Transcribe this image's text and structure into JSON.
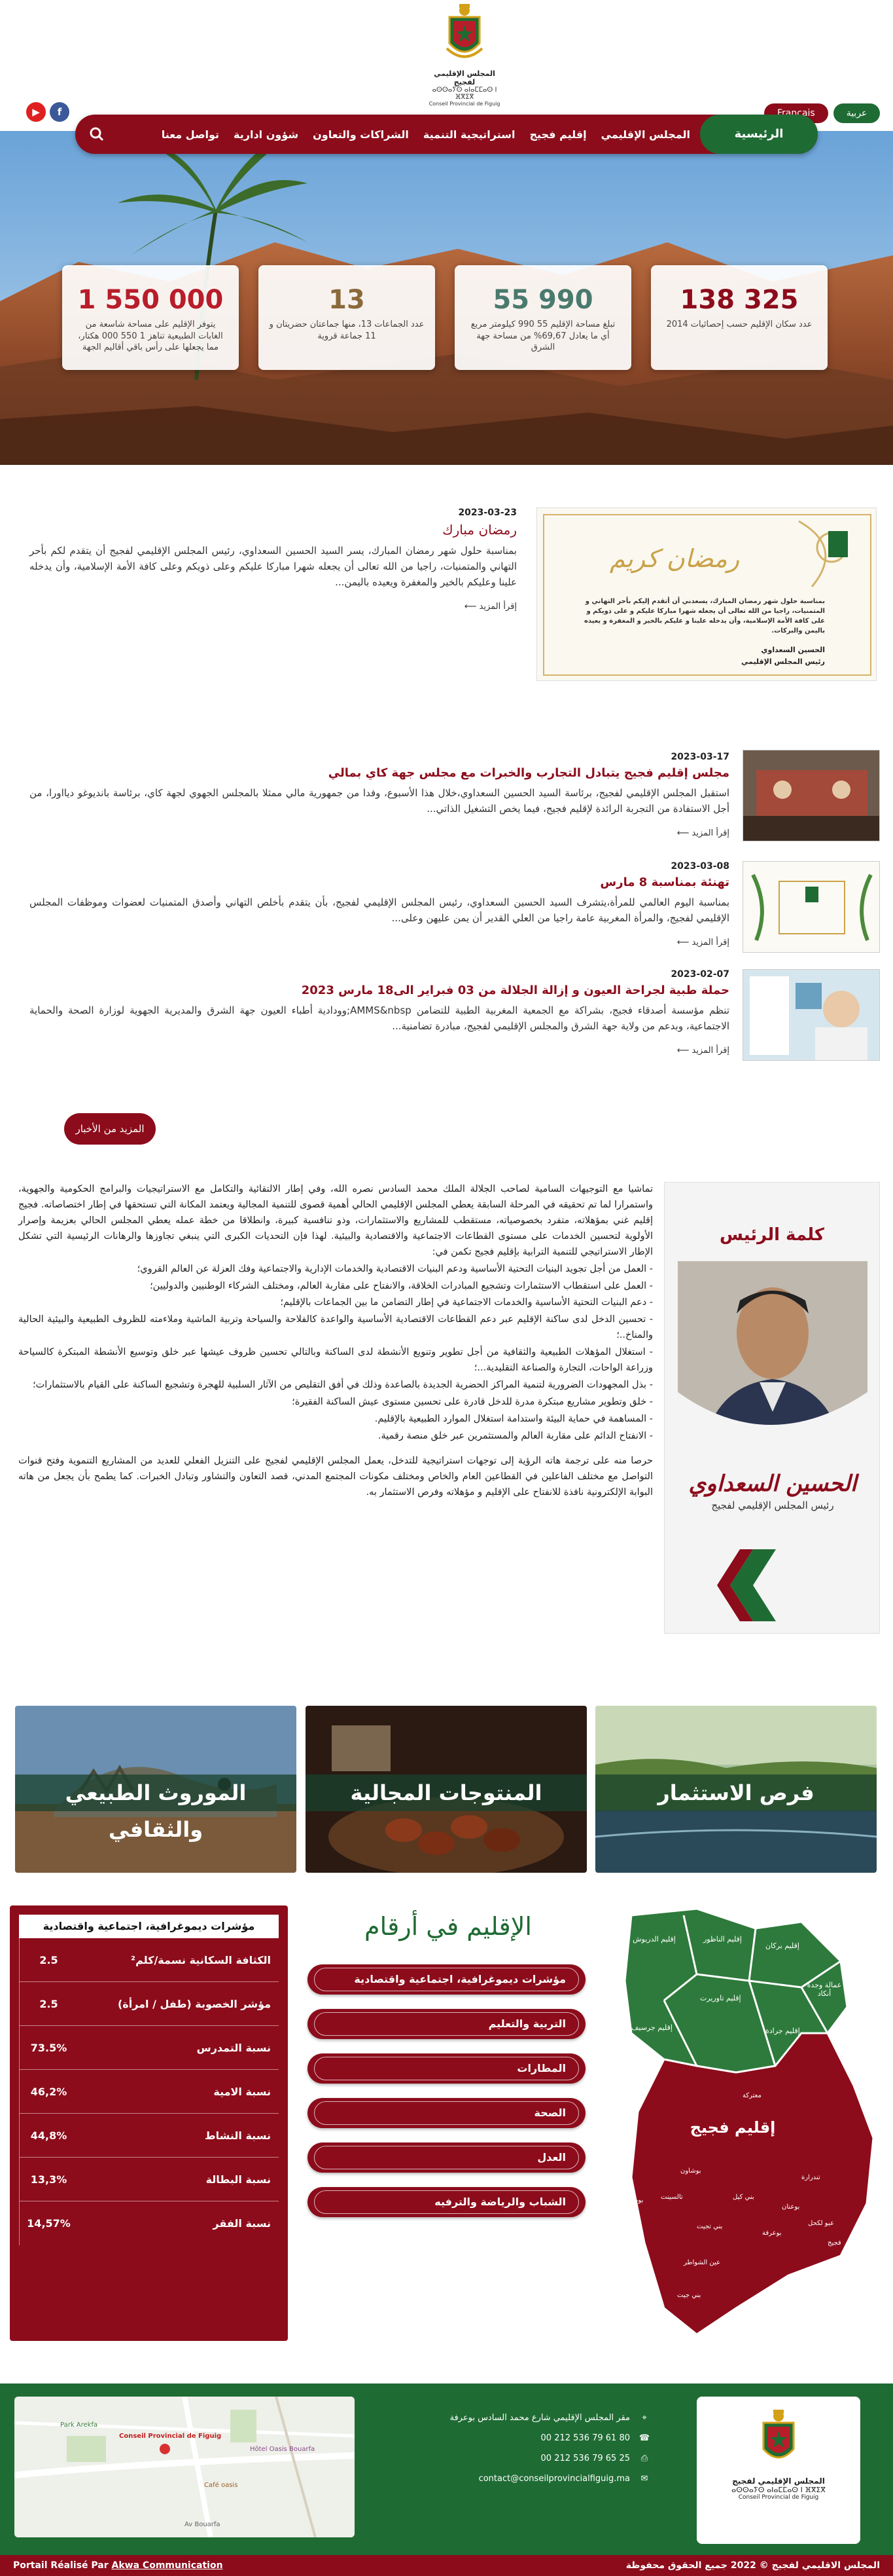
{
  "header": {
    "logo_lines": [
      "المجلس الإقليمي لفجيج",
      "ⴰⵙⵙⴰⵢⵙ ⴰⵏⴰⵎⵎⴰⵙ ⵏ ⴼⴳⵉⴳ",
      "Conseil Provincial de Figuig"
    ],
    "lang_ar": "عربية",
    "lang_fr": "Français",
    "nav_home": "الرئيسية",
    "nav_items": [
      "المجلس الإقليمي",
      "إقليم فجيج",
      "استراتيجية التنمية",
      "الشراكات والتعاون",
      "شؤون ادارية",
      "تواصل معنا"
    ]
  },
  "stats": [
    {
      "num": "138 325",
      "desc": "عدد سكان الإقليم حسب إحصائيات 2014",
      "color": "#8c0c1b"
    },
    {
      "num": "55 990",
      "desc": "تبلغ مساحة الإقليم 55 990 كيلومتر مربع أي ما يعادل 69,67% من مساحة جهة الشرق",
      "color": "#4a7a6e"
    },
    {
      "num": "13",
      "desc": "عدد الجماعات 13، منها جماعتان حضريتان و 11 جماعة قروية",
      "color": "#8a6a3a"
    },
    {
      "num": "1 550 000",
      "desc": "يتوفر الإقليم على مساحة شاسعة من الغابات الطبيعية تناهز 1 550 000 هكتار، مما يجعلها على رأس باقي أقاليم الجهة",
      "color": "#b81d2a"
    }
  ],
  "news": [
    {
      "date": "2023-03-23",
      "title": "رمضان مبارك",
      "excerpt": "بمناسبة حلول شهر رمضان المبارك، يسر السيد الحسين السعداوي، رئيس المجلس الإقليمي لفجيج أن يتقدم لكم بأحر التهاني والمتمنيات، راجيا من الله تعالى أن يجعله شهرا مباركا عليكم وعلى ذويكم وعلى كافة الأمة الإسلامية، وأن يدخله علينا وعليكم بالخير والمغفرة ويعيده باليمن...",
      "read_more": "إقرأ المزيد"
    },
    {
      "date": "2023-03-17",
      "title": "مجلس إقليم فجيج يتبادل التجارب والخبرات مع مجلس جهة كاي بمالي",
      "excerpt": "استقبل المجلس الإقليمي لفجيج، برئاسة السيد الحسين السعداوي،خلال هذا الأسبوع، وفدا من جمهورية مالي ممثلا بالمجلس الجهوي لجهة كاي، برئاسة بانديوغو ديااورا، من أجل الاستفادة من التجربة الرائدة لإقليم فجيج، فيما يخص التشغيل الذاتي...",
      "read_more": "إقرأ المزيد"
    },
    {
      "date": "2023-03-08",
      "title": "تهنئة بمناسبة 8 مارس",
      "excerpt": "بمناسبة اليوم العالمي للمرأة،يتشرف السيد الحسين السعداوي، رئيس المجلس الإقليمي لفجيج، بأن يتقدم بأخلص التهاني وأصدق المتمنيات لعضوات وموظفات المجلس الإقليمي لفجيج، والمرأة المغربية عامة راجيا من العلي القدير أن يمن عليهن وعلى...",
      "read_more": "إقرأ المزيد"
    },
    {
      "date": "2023-02-07",
      "title": "حملة طبية لجراحة العيون و إزالة الجلالة من 03 فبراير الى18 مارس 2023",
      "excerpt": "تنظم مؤسسة أصدقاء فجيج، بشراكة مع الجمعية المغربية الطبية للتضامن AMMS&nbsp;وودادية أطباء العيون جهة الشرق والمديرية الجهوية لوزارة الصحة والحماية الاجتماعية، وبدعم من ولاية جهة الشرق والمجلس الإقليمي لفجيج، مبادرة تضامنية...",
      "read_more": "إقرأ المزيد"
    }
  ],
  "featured_card": {
    "greeting": "رمضان كريم",
    "text": "بمناسبة حلول شهر رمضان المبارك، يسعدني أن أتقدم إليكم بأحر التهاني و المتمنيات، راجيا من الله تعالى أن يجعله شهرا مباركا عليكم و على ذويكم و على كافة الأمة الإسلامية، وأن يدخله علينا و عليكم بالخير و المغفرة و يعيده باليمن والبركات.",
    "signature": "الحسين السعداوي",
    "signature_role": "رئيس المجلس الإقليمي"
  },
  "more_button": "المزيد من الأخبار",
  "president": {
    "heading": "كلمة الرئيس",
    "name": "الحسين السعداوي",
    "role": "رئيس المجلس الإقليمي لفجيج",
    "paragraphs": [
      "تماشيا مع التوجيهات السامية لصاحب الجلالة الملك محمد السادس نصره الله، وفي إطار الالتقائية والتكامل مع الاستراتيجيات والبرامج الحكومية والجهوية، واستمرارا لما تم تحقيقه في المرحلة السابقة يعطي المجلس الإقليمي الحالي أهمية قصوى للتنمية المجالية ويعتمد المكانة التي تستحقها في إطار اختصاصاته. فجيج إقليم غني بمؤهلاته، متفرد بخصوصياته، مستقطب للمشاريع والاستثمارات، وذو تنافسية كبيرة، وانطلاقا من خطة عمله يعطي المجلس الحالي بعزيمة وإصرار الأولوية لتحسين الخدمات على مستوى القطاعات الاجتماعية والاقتصادية والبيئية. لهذا فإن التحديات الكبرى التي ينبغي تجاوزها والرهانات الرئيسية التي تشكل الإطار الاستراتيجي للتنمية الترابية بإقليم فجيج تكمن في:",
      "- العمل من أجل تجويد البنيات التحتية الأساسية ودعم البنيات الاقتصادية والخدمات الإدارية والاجتماعية وفك العزلة عن العالم القروي؛",
      "- العمل على استقطاب الاستثمارات وتشجيع المبادرات الخلاقة، والانفتاح على مقاربة العالم، ومختلف الشركاء الوطنيين والدوليين؛",
      "- دعم البنيات التحتية الأساسية والخدمات الاجتماعية في إطار التضامن ما بين الجماعات بالإقليم؛",
      "- تحسين الدخل لدى ساكنة الإقليم عبر دعم القطاعات الاقتصادية الأساسية والواعدة كالفلاحة والسياحة وتربية الماشية وملاءمته للظروف الطبيعية والبيئية الحالية والمناخ..؛",
      "- استغلال المؤهلات الطبيعية والثقافية من أجل تطوير وتنويع الأنشطة لدى الساكنة وبالتالي تحسين ظروف عيشها عبر خلق وتوسيع الأنشطة المبتكرة كالسياحة وزراعة الواحات، التجارة والصناعة التقليدية...؛",
      "- بذل المجهودات الضرورية لتنمية المراكز الحضرية الجديدة بالصاعدة وذلك في أفق التقليص من الآثار السلبية للهجرة وتشجيع الساكنة على القيام بالاستثمارات؛",
      "- خلق وتطوير مشاريع مبتكرة مدرة للدخل قادرة على تحسين مستوى عيش الساكنة الفقيرة؛",
      "- المساهمة في حماية البيئة واستدامة استغلال الموارد الطبيعية بالإقليم.",
      "- الانفتاح الدائم على مقاربة العالم والمستثمرين عبر خلق منصة رقمية.",
      "حرصا منه على ترجمة هاته الرؤية إلى توجهات استراتيجية للتدخل، يعمل المجلس الإقليمي لفجيج على التنزيل الفعلي للعديد من المشاريع التنموية وفتح قنوات التواصل مع مختلف الفاعلين في القطاعين العام والخاص ومختلف مكونات المجتمع المدني، قصد التعاون والتشاور وتبادل الخبرات. كما يطمح بأن يجعل من هاته البوابة الإلكترونية نافذة للانفتاح على الإقليم و مؤهلاته وفرص الاستثمار به."
    ]
  },
  "cards": [
    "فرص الاستثمار",
    "المنتوجات المجالية",
    "الموروث الطبيعي والثقافي"
  ],
  "indicators": {
    "header": "مؤشرات ديموغرافية، اجتماعية واقتصادية",
    "rows": [
      {
        "label": "الكثافة السكانية نسمة/كلم²",
        "value": "2.5"
      },
      {
        "label": "مؤشر الخصوبة (طفل / امرأة)",
        "value": "2.5"
      },
      {
        "label": "نسبة التمدرس",
        "value": "73.5%"
      },
      {
        "label": "نسبة الامية",
        "value": "46,2%"
      },
      {
        "label": "نسبة النشاط",
        "value": "44,8%"
      },
      {
        "label": "نسبة البطالة",
        "value": "13,3%"
      },
      {
        "label": "نسبة الفقر",
        "value": "14,57%"
      }
    ]
  },
  "figures": {
    "title": "الإقليم في أرقام",
    "buttons": [
      "مؤشرات ديموغرافية، اجتماعية واقتصادية",
      "التربية والتعليم",
      "المطارات",
      "الصحة",
      "العدل",
      "الشباب والرياضة والترفيه"
    ]
  },
  "map": {
    "region_label": "إقليم فجيج",
    "other_provinces": [
      "إقليم الدريوش",
      "إقليم الناظور",
      "إقليم بركان",
      "عمالة وجدة أنكاد",
      "إقليم تاوريرت",
      "إقليم جرسيف",
      "إقليم جرادة"
    ],
    "towns": [
      "معتركة",
      "تندرارة",
      "بوشاون",
      "بني تجيت",
      "عبو لكحل",
      "بوعنان",
      "بوعرفة",
      "تالسينت",
      "بني كيل",
      "فجيج",
      "بومريم",
      "عين الشواطر",
      "بني جيت"
    ]
  },
  "footer": {
    "address": "مقر المجلس الإقليمي شارع محمد السادس بوعرفة",
    "phone1": "00 212 536 79 61 80",
    "phone2": "00 212 536 79 65 25",
    "email": "contact@conseilprovincialfiguig.ma",
    "map_labels": [
      "Park Arekfa",
      "Conseil Provincial de Figuig",
      "Hôtel Oasis Bouarfa",
      "Café oasis",
      "Av Bouarfa"
    ]
  },
  "bottom": {
    "copyright": "المجلس الاقليمي لفجيج © 2022 جميع الحقوق محفوظة",
    "credit_prefix": "Portail Réalisé Par",
    "credit_link": "Akwa Communication"
  },
  "colors": {
    "brand_red": "#8c0c1b",
    "brand_green": "#1f6b34"
  }
}
